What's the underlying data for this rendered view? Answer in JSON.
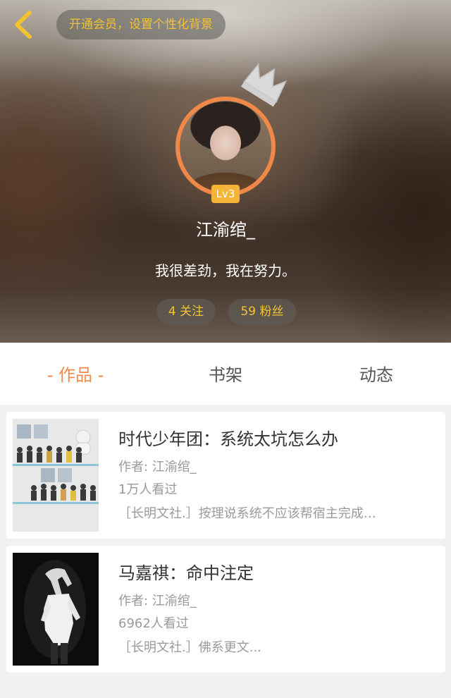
{
  "header": {
    "back_icon": "chevron-left-icon",
    "member_banner": "开通会员，设置个性化背景",
    "crown_icon": "crown-icon",
    "level": "Lv3",
    "username": "江渝绾_",
    "bio": "我很差劲，我在努力。",
    "follow_label": "4 关注",
    "fans_label": "59 粉丝",
    "accent_color": "#f2c230"
  },
  "tabs": [
    {
      "label": "- 作品 -",
      "active": true
    },
    {
      "label": "书架",
      "active": false
    },
    {
      "label": "动态",
      "active": false
    }
  ],
  "active_tab_color": "#f08a4b",
  "works": [
    {
      "title": "时代少年团：系统太坑怎么办",
      "author": "作者: 江渝绾_",
      "views": "1万人看过",
      "description": "［长明文社.］按理说系统不应该帮宿主完成…"
    },
    {
      "title": "马嘉祺：命中注定",
      "author": "作者: 江渝绾_",
      "views": "6962人看过",
      "description": "［长明文社.］佛系更文..."
    }
  ]
}
